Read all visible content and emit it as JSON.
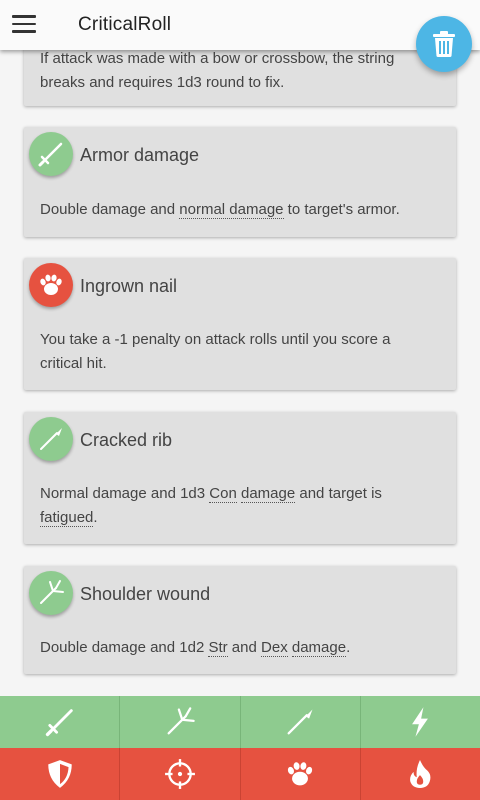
{
  "app": {
    "title": "CriticalRoll"
  },
  "colors": {
    "green": "#8ecb8f",
    "red": "#e65240",
    "fab": "#4db6e5",
    "card": "#e0e0e0"
  },
  "fab": {
    "icon": "trash-icon"
  },
  "cards": [
    {
      "icon": "bow-icon",
      "color": "green",
      "title": "",
      "desc_lines": [
        "If attack was made with a bow or crossbow, the string",
        "breaks and requires 1d3 round to fix."
      ]
    },
    {
      "icon": "sword-icon",
      "color": "green",
      "title": "Armor damage",
      "desc_pre": "Double damage and ",
      "link1": "normal damage",
      "desc_post": " to target's armor."
    },
    {
      "icon": "claw-icon",
      "color": "red",
      "title": "Ingrown nail",
      "desc": "You take a -1 penalty on attack rolls until you score a critical hit."
    },
    {
      "icon": "spear-icon",
      "color": "green",
      "title": "Cracked rib",
      "desc_pre": "Normal damage and 1d3 ",
      "link1": "Con",
      "mid1": " ",
      "link2": "damage",
      "desc_mid": " and target is ",
      "link3": "fatigued",
      "desc_post": "."
    },
    {
      "icon": "trident-icon",
      "color": "green",
      "title": "Shoulder wound",
      "desc_pre": "Double damage and 1d2 ",
      "link1": "Str",
      "mid1": " and ",
      "link2": "Dex",
      "mid2": " ",
      "link3": "damage",
      "desc_post": "."
    }
  ],
  "bottom_green": [
    "sword-icon",
    "trident-icon",
    "spear-icon",
    "lightning-icon"
  ],
  "bottom_red": [
    "shield-icon",
    "crosshair-icon",
    "claw-icon",
    "fire-icon"
  ]
}
